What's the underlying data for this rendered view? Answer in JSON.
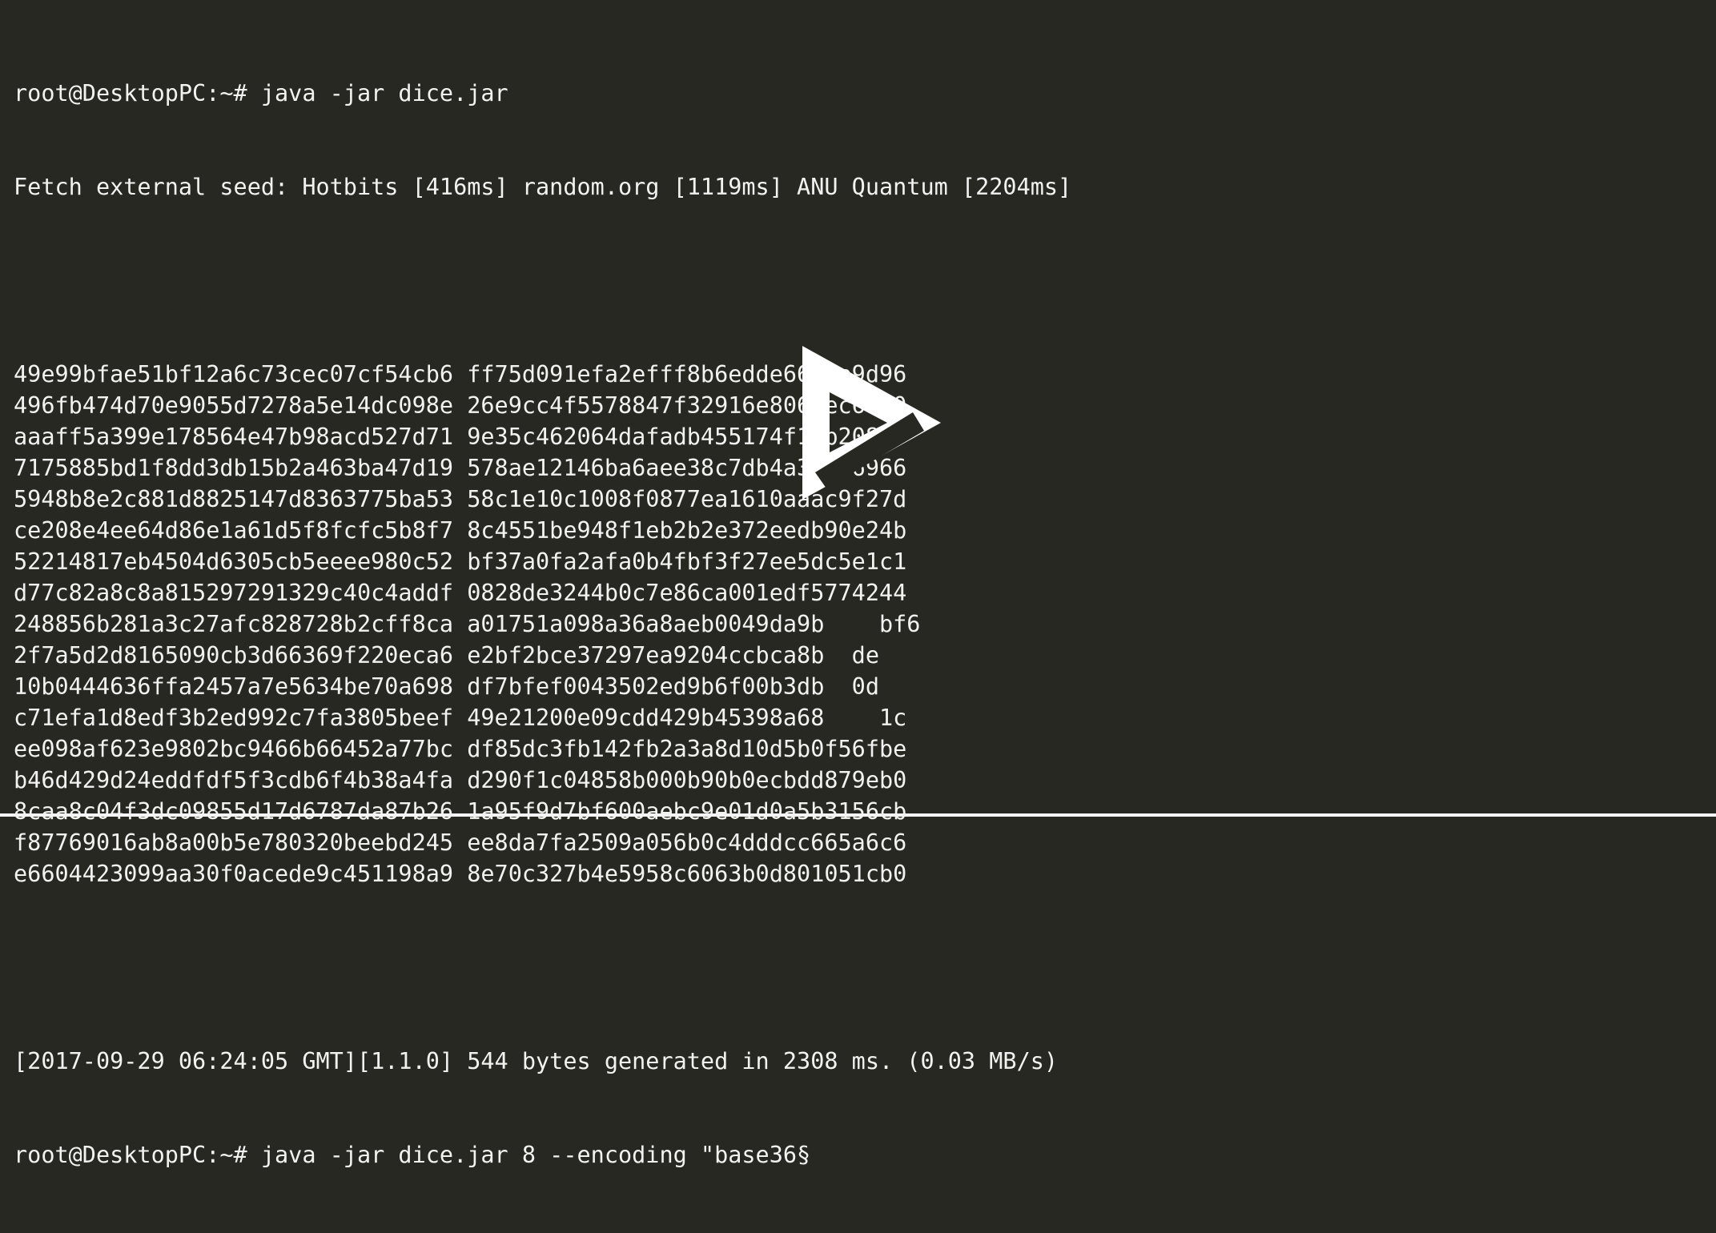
{
  "terminal": {
    "prompt_1": "root@DesktopPC:~# java -jar dice.jar",
    "seed_line": "Fetch external seed: Hotbits [416ms] random.org [1119ms] ANU Quantum [2204ms]",
    "output_rows": [
      "49e99bfae51bf12a6c73cec07cf54cb6 ff75d091efa2efff8b6edde6678e9d96",
      "496fb474d70e9055d7278a5e14dc098e 26e9cc4f5578847f32916e8061ec6af0",
      "aaaff5a399e178564e47b98acd527d71 9e35c462064dafadb455174f1bb2080f",
      "7175885bd1f8dd3db15b2a463ba47d19 578ae12146ba6aee38c7db4a37d46966",
      "5948b8e2c881d8825147d8363775ba53 58c1e10c1008f0877ea1610aaac9f27d",
      "ce208e4ee64d86e1a61d5f8fcfc5b8f7 8c4551be948f1eb2b2e372eedb90e24b",
      "52214817eb4504d6305cb5eeee980c52 bf37a0fa2afa0b4fbf3f27ee5dc5e1c1",
      "d77c82a8c8a815297291329c40c4addf 0828de3244b0c7e86ca001edf5774244",
      "248856b281a3c27afc828728b2cff8ca a01751a098a36a8aeb0049da9b    bf6",
      "2f7a5d2d8165090cb3d66369f220eca6 e2bf2bce37297ea9204ccbca8b  de",
      "10b0444636ffa2457a7e5634be70a698 df7bfef0043502ed9b6f00b3db  0d",
      "c71efa1d8edf3b2ed992c7fa3805beef 49e21200e09cdd429b45398a68    1c",
      "ee098af623e9802bc9466b66452a77bc df85dc3fb142fb2a3a8d10d5b0f56fbe",
      "b46d429d24eddfdf5f3cdb6f4b38a4fa d290f1c04858b000b90b0ecbdd879eb0",
      "8caa8c04f3dc09855d17d6787da87b26 1a95f9d7bf600aebc9e01d0a5b3156cb",
      "f87769016ab8a00b5e780320beebd245 ee8da7fa2509a056b0c4dddcc665a6c6",
      "e6604423099aa30f0acede9c451198a9 8e70c327b4e5958c6063b0d801051cb0"
    ],
    "status_line": "[2017-09-29 06:24:05 GMT][1.1.0] 544 bytes generated in 2308 ms. (0.03 MB/s)",
    "prompt_2": "root@DesktopPC:~# java -jar dice.jar 8 --encoding \"base36§"
  },
  "overlay": {
    "icon": "play-icon"
  },
  "colors": {
    "background": "#272822",
    "foreground": "#f2f2f0",
    "overlay_icon": "#ffffff"
  }
}
